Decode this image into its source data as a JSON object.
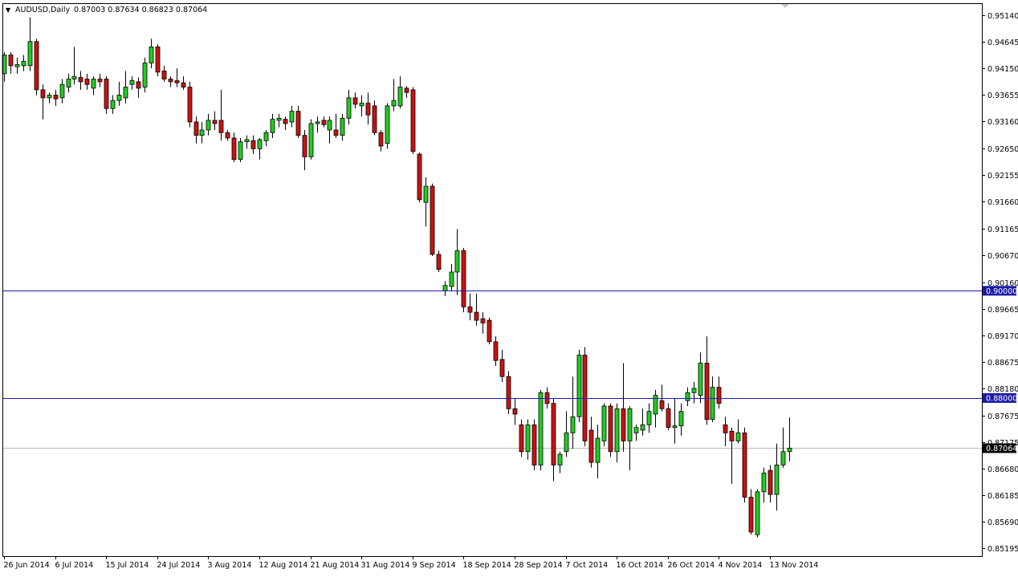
{
  "header": {
    "dropdown_glyph": "▼",
    "symbol_label": "AUDUSD,Daily",
    "ohlc_text": "0.87003 0.87634 0.86823 0.87064"
  },
  "colors": {
    "up_body": "#22cc22",
    "down_body": "#cc1111",
    "wick": "#000000",
    "level_line": "#1a1aa8",
    "level_label_bg": "#1a1aa8",
    "price_line": "#b8b8b8",
    "current_label_bg": "#000000",
    "axis": "#000000",
    "background": "#ffffff"
  },
  "chart_data": {
    "type": "candlestick",
    "symbol": "AUDUSD",
    "timeframe": "Daily",
    "ylim": [
      0.8505,
      0.9535
    ],
    "y_ticks": [
      "0.95140",
      "0.94645",
      "0.94150",
      "0.93655",
      "0.93160",
      "0.92650",
      "0.92155",
      "0.91660",
      "0.91165",
      "0.90670",
      "0.90160",
      "0.89665",
      "0.89170",
      "0.88675",
      "0.88180",
      "0.87675",
      "0.87175",
      "0.86680",
      "0.86185",
      "0.85690",
      "0.85195"
    ],
    "x_ticks": [
      {
        "label": "26 Jun 2014",
        "index": 0
      },
      {
        "label": "6 Jul 2014",
        "index": 8
      },
      {
        "label": "15 Jul 2014",
        "index": 16
      },
      {
        "label": "24 Jul 2014",
        "index": 24
      },
      {
        "label": "3 Aug 2014",
        "index": 32
      },
      {
        "label": "12 Aug 2014",
        "index": 40
      },
      {
        "label": "21 Aug 2014",
        "index": 48
      },
      {
        "label": "31 Aug 2014",
        "index": 56
      },
      {
        "label": "9 Sep 2014",
        "index": 64
      },
      {
        "label": "18 Sep 2014",
        "index": 72
      },
      {
        "label": "28 Sep 2014",
        "index": 80
      },
      {
        "label": "7 Oct 2014",
        "index": 88
      },
      {
        "label": "16 Oct 2014",
        "index": 96
      },
      {
        "label": "26 Oct 2014",
        "index": 104
      },
      {
        "label": "4 Nov 2014",
        "index": 112
      },
      {
        "label": "13 Nov 2014",
        "index": 120
      }
    ],
    "horizontal_levels": [
      {
        "price": 0.9,
        "label": "0.90000"
      },
      {
        "price": 0.88,
        "label": "0.88000"
      }
    ],
    "current_price": {
      "price": 0.87064,
      "label": "0.87064"
    },
    "candles": [
      {
        "o": 0.9405,
        "h": 0.9445,
        "l": 0.939,
        "c": 0.944
      },
      {
        "o": 0.944,
        "h": 0.9445,
        "l": 0.9405,
        "c": 0.942
      },
      {
        "o": 0.9418,
        "h": 0.9435,
        "l": 0.9405,
        "c": 0.9422
      },
      {
        "o": 0.942,
        "h": 0.944,
        "l": 0.941,
        "c": 0.9428
      },
      {
        "o": 0.942,
        "h": 0.951,
        "l": 0.941,
        "c": 0.9465
      },
      {
        "o": 0.9465,
        "h": 0.947,
        "l": 0.9365,
        "c": 0.9375
      },
      {
        "o": 0.9375,
        "h": 0.9385,
        "l": 0.932,
        "c": 0.936
      },
      {
        "o": 0.936,
        "h": 0.937,
        "l": 0.935,
        "c": 0.9365
      },
      {
        "o": 0.9365,
        "h": 0.9375,
        "l": 0.9345,
        "c": 0.9358
      },
      {
        "o": 0.936,
        "h": 0.9395,
        "l": 0.935,
        "c": 0.9385
      },
      {
        "o": 0.938,
        "h": 0.9405,
        "l": 0.937,
        "c": 0.9395
      },
      {
        "o": 0.9395,
        "h": 0.9455,
        "l": 0.9385,
        "c": 0.94
      },
      {
        "o": 0.9398,
        "h": 0.941,
        "l": 0.9375,
        "c": 0.939
      },
      {
        "o": 0.9395,
        "h": 0.9405,
        "l": 0.9375,
        "c": 0.9385
      },
      {
        "o": 0.9378,
        "h": 0.94,
        "l": 0.9365,
        "c": 0.9395
      },
      {
        "o": 0.9395,
        "h": 0.9405,
        "l": 0.938,
        "c": 0.939
      },
      {
        "o": 0.9395,
        "h": 0.94,
        "l": 0.933,
        "c": 0.934
      },
      {
        "o": 0.934,
        "h": 0.9365,
        "l": 0.933,
        "c": 0.9355
      },
      {
        "o": 0.9355,
        "h": 0.939,
        "l": 0.9345,
        "c": 0.9365
      },
      {
        "o": 0.936,
        "h": 0.941,
        "l": 0.935,
        "c": 0.938
      },
      {
        "o": 0.9385,
        "h": 0.94,
        "l": 0.9375,
        "c": 0.9392
      },
      {
        "o": 0.939,
        "h": 0.9398,
        "l": 0.936,
        "c": 0.9378
      },
      {
        "o": 0.938,
        "h": 0.9435,
        "l": 0.937,
        "c": 0.9425
      },
      {
        "o": 0.9425,
        "h": 0.947,
        "l": 0.9415,
        "c": 0.9455
      },
      {
        "o": 0.9455,
        "h": 0.946,
        "l": 0.94,
        "c": 0.9408
      },
      {
        "o": 0.941,
        "h": 0.942,
        "l": 0.939,
        "c": 0.9395
      },
      {
        "o": 0.9395,
        "h": 0.94,
        "l": 0.938,
        "c": 0.939
      },
      {
        "o": 0.9392,
        "h": 0.9415,
        "l": 0.938,
        "c": 0.9388
      },
      {
        "o": 0.9388,
        "h": 0.94,
        "l": 0.9375,
        "c": 0.938
      },
      {
        "o": 0.938,
        "h": 0.939,
        "l": 0.9305,
        "c": 0.9315
      },
      {
        "o": 0.9315,
        "h": 0.9325,
        "l": 0.9275,
        "c": 0.929
      },
      {
        "o": 0.929,
        "h": 0.9315,
        "l": 0.9275,
        "c": 0.93
      },
      {
        "o": 0.93,
        "h": 0.933,
        "l": 0.929,
        "c": 0.9318
      },
      {
        "o": 0.9318,
        "h": 0.9335,
        "l": 0.93,
        "c": 0.9312
      },
      {
        "o": 0.9318,
        "h": 0.9375,
        "l": 0.928,
        "c": 0.9295
      },
      {
        "o": 0.9295,
        "h": 0.93,
        "l": 0.928,
        "c": 0.9285
      },
      {
        "o": 0.9285,
        "h": 0.9295,
        "l": 0.924,
        "c": 0.9245
      },
      {
        "o": 0.9245,
        "h": 0.9285,
        "l": 0.924,
        "c": 0.9278
      },
      {
        "o": 0.9278,
        "h": 0.929,
        "l": 0.9265,
        "c": 0.9282
      },
      {
        "o": 0.928,
        "h": 0.929,
        "l": 0.9255,
        "c": 0.9265
      },
      {
        "o": 0.9265,
        "h": 0.9285,
        "l": 0.9245,
        "c": 0.9282
      },
      {
        "o": 0.928,
        "h": 0.93,
        "l": 0.927,
        "c": 0.9295
      },
      {
        "o": 0.9295,
        "h": 0.933,
        "l": 0.9285,
        "c": 0.932
      },
      {
        "o": 0.9318,
        "h": 0.933,
        "l": 0.9305,
        "c": 0.9322
      },
      {
        "o": 0.932,
        "h": 0.9325,
        "l": 0.93,
        "c": 0.9312
      },
      {
        "o": 0.9315,
        "h": 0.9345,
        "l": 0.9305,
        "c": 0.9335
      },
      {
        "o": 0.9335,
        "h": 0.9345,
        "l": 0.9285,
        "c": 0.929
      },
      {
        "o": 0.929,
        "h": 0.93,
        "l": 0.9225,
        "c": 0.925
      },
      {
        "o": 0.925,
        "h": 0.932,
        "l": 0.9245,
        "c": 0.9312
      },
      {
        "o": 0.9312,
        "h": 0.9325,
        "l": 0.9295,
        "c": 0.9315
      },
      {
        "o": 0.9318,
        "h": 0.9325,
        "l": 0.9305,
        "c": 0.931
      },
      {
        "o": 0.93,
        "h": 0.9325,
        "l": 0.9275,
        "c": 0.9318
      },
      {
        "o": 0.93,
        "h": 0.933,
        "l": 0.9285,
        "c": 0.929
      },
      {
        "o": 0.929,
        "h": 0.933,
        "l": 0.928,
        "c": 0.9322
      },
      {
        "o": 0.9322,
        "h": 0.9375,
        "l": 0.931,
        "c": 0.936
      },
      {
        "o": 0.936,
        "h": 0.937,
        "l": 0.934,
        "c": 0.9348
      },
      {
        "o": 0.9345,
        "h": 0.9365,
        "l": 0.9325,
        "c": 0.935
      },
      {
        "o": 0.935,
        "h": 0.937,
        "l": 0.931,
        "c": 0.9328
      },
      {
        "o": 0.9345,
        "h": 0.9355,
        "l": 0.929,
        "c": 0.9295
      },
      {
        "o": 0.9295,
        "h": 0.93,
        "l": 0.926,
        "c": 0.927
      },
      {
        "o": 0.9275,
        "h": 0.935,
        "l": 0.9265,
        "c": 0.9345
      },
      {
        "o": 0.9345,
        "h": 0.9395,
        "l": 0.9335,
        "c": 0.9355
      },
      {
        "o": 0.9345,
        "h": 0.94,
        "l": 0.934,
        "c": 0.938
      },
      {
        "o": 0.9378,
        "h": 0.9382,
        "l": 0.936,
        "c": 0.937
      },
      {
        "o": 0.9375,
        "h": 0.938,
        "l": 0.9255,
        "c": 0.926
      },
      {
        "o": 0.9255,
        "h": 0.9258,
        "l": 0.9165,
        "c": 0.917
      },
      {
        "o": 0.9165,
        "h": 0.9212,
        "l": 0.912,
        "c": 0.9195
      },
      {
        "o": 0.9195,
        "h": 0.92,
        "l": 0.9065,
        "c": 0.9068
      },
      {
        "o": 0.9068,
        "h": 0.9075,
        "l": 0.9035,
        "c": 0.904
      },
      {
        "o": 0.9,
        "h": 0.9018,
        "l": 0.899,
        "c": 0.901
      },
      {
        "o": 0.9008,
        "h": 0.905,
        "l": 0.9,
        "c": 0.9035
      },
      {
        "o": 0.9035,
        "h": 0.9115,
        "l": 0.8992,
        "c": 0.9075
      },
      {
        "o": 0.9075,
        "h": 0.908,
        "l": 0.896,
        "c": 0.897
      },
      {
        "o": 0.897,
        "h": 0.8995,
        "l": 0.8945,
        "c": 0.896
      },
      {
        "o": 0.896,
        "h": 0.8995,
        "l": 0.8935,
        "c": 0.8945
      },
      {
        "o": 0.8948,
        "h": 0.896,
        "l": 0.892,
        "c": 0.894
      },
      {
        "o": 0.8945,
        "h": 0.895,
        "l": 0.89,
        "c": 0.8905
      },
      {
        "o": 0.8905,
        "h": 0.8915,
        "l": 0.886,
        "c": 0.887
      },
      {
        "o": 0.8872,
        "h": 0.889,
        "l": 0.883,
        "c": 0.884
      },
      {
        "o": 0.884,
        "h": 0.885,
        "l": 0.877,
        "c": 0.878
      },
      {
        "o": 0.878,
        "h": 0.88,
        "l": 0.875,
        "c": 0.877
      },
      {
        "o": 0.875,
        "h": 0.876,
        "l": 0.869,
        "c": 0.87
      },
      {
        "o": 0.87,
        "h": 0.876,
        "l": 0.8685,
        "c": 0.875
      },
      {
        "o": 0.875,
        "h": 0.876,
        "l": 0.8665,
        "c": 0.8675
      },
      {
        "o": 0.8675,
        "h": 0.8815,
        "l": 0.8665,
        "c": 0.881
      },
      {
        "o": 0.881,
        "h": 0.882,
        "l": 0.878,
        "c": 0.879
      },
      {
        "o": 0.879,
        "h": 0.88,
        "l": 0.8645,
        "c": 0.8675
      },
      {
        "o": 0.8675,
        "h": 0.87,
        "l": 0.866,
        "c": 0.8695
      },
      {
        "o": 0.87,
        "h": 0.8775,
        "l": 0.869,
        "c": 0.8735
      },
      {
        "o": 0.8735,
        "h": 0.884,
        "l": 0.8705,
        "c": 0.8765
      },
      {
        "o": 0.8765,
        "h": 0.889,
        "l": 0.8755,
        "c": 0.888
      },
      {
        "o": 0.888,
        "h": 0.8895,
        "l": 0.871,
        "c": 0.872
      },
      {
        "o": 0.874,
        "h": 0.8765,
        "l": 0.867,
        "c": 0.868
      },
      {
        "o": 0.868,
        "h": 0.875,
        "l": 0.865,
        "c": 0.8725
      },
      {
        "o": 0.872,
        "h": 0.879,
        "l": 0.871,
        "c": 0.8785
      },
      {
        "o": 0.8785,
        "h": 0.879,
        "l": 0.869,
        "c": 0.87
      },
      {
        "o": 0.87,
        "h": 0.879,
        "l": 0.868,
        "c": 0.878
      },
      {
        "o": 0.878,
        "h": 0.8865,
        "l": 0.87,
        "c": 0.872
      },
      {
        "o": 0.872,
        "h": 0.8785,
        "l": 0.8665,
        "c": 0.878
      },
      {
        "o": 0.8735,
        "h": 0.875,
        "l": 0.872,
        "c": 0.8745
      },
      {
        "o": 0.874,
        "h": 0.878,
        "l": 0.873,
        "c": 0.875
      },
      {
        "o": 0.875,
        "h": 0.879,
        "l": 0.8735,
        "c": 0.8775
      },
      {
        "o": 0.877,
        "h": 0.8815,
        "l": 0.8745,
        "c": 0.8805
      },
      {
        "o": 0.8795,
        "h": 0.8825,
        "l": 0.8775,
        "c": 0.878
      },
      {
        "o": 0.878,
        "h": 0.879,
        "l": 0.874,
        "c": 0.8745
      },
      {
        "o": 0.8745,
        "h": 0.88,
        "l": 0.8715,
        "c": 0.8748
      },
      {
        "o": 0.8748,
        "h": 0.879,
        "l": 0.873,
        "c": 0.8775
      },
      {
        "o": 0.8795,
        "h": 0.882,
        "l": 0.8785,
        "c": 0.881
      },
      {
        "o": 0.881,
        "h": 0.883,
        "l": 0.879,
        "c": 0.8818
      },
      {
        "o": 0.8805,
        "h": 0.8885,
        "l": 0.879,
        "c": 0.8865
      },
      {
        "o": 0.8865,
        "h": 0.8915,
        "l": 0.875,
        "c": 0.876
      },
      {
        "o": 0.876,
        "h": 0.884,
        "l": 0.8755,
        "c": 0.882
      },
      {
        "o": 0.882,
        "h": 0.884,
        "l": 0.878,
        "c": 0.879
      },
      {
        "o": 0.875,
        "h": 0.8765,
        "l": 0.871,
        "c": 0.8735
      },
      {
        "o": 0.8738,
        "h": 0.8745,
        "l": 0.864,
        "c": 0.872
      },
      {
        "o": 0.872,
        "h": 0.876,
        "l": 0.8715,
        "c": 0.8735
      },
      {
        "o": 0.8735,
        "h": 0.8745,
        "l": 0.8605,
        "c": 0.8615
      },
      {
        "o": 0.8615,
        "h": 0.863,
        "l": 0.8545,
        "c": 0.855
      },
      {
        "o": 0.8545,
        "h": 0.863,
        "l": 0.854,
        "c": 0.8625
      },
      {
        "o": 0.8625,
        "h": 0.867,
        "l": 0.8605,
        "c": 0.866
      },
      {
        "o": 0.8665,
        "h": 0.8675,
        "l": 0.8605,
        "c": 0.862
      },
      {
        "o": 0.862,
        "h": 0.8715,
        "l": 0.859,
        "c": 0.8675
      },
      {
        "o": 0.8675,
        "h": 0.8745,
        "l": 0.867,
        "c": 0.87
      },
      {
        "o": 0.87003,
        "h": 0.87634,
        "l": 0.86823,
        "c": 0.87064
      }
    ]
  }
}
